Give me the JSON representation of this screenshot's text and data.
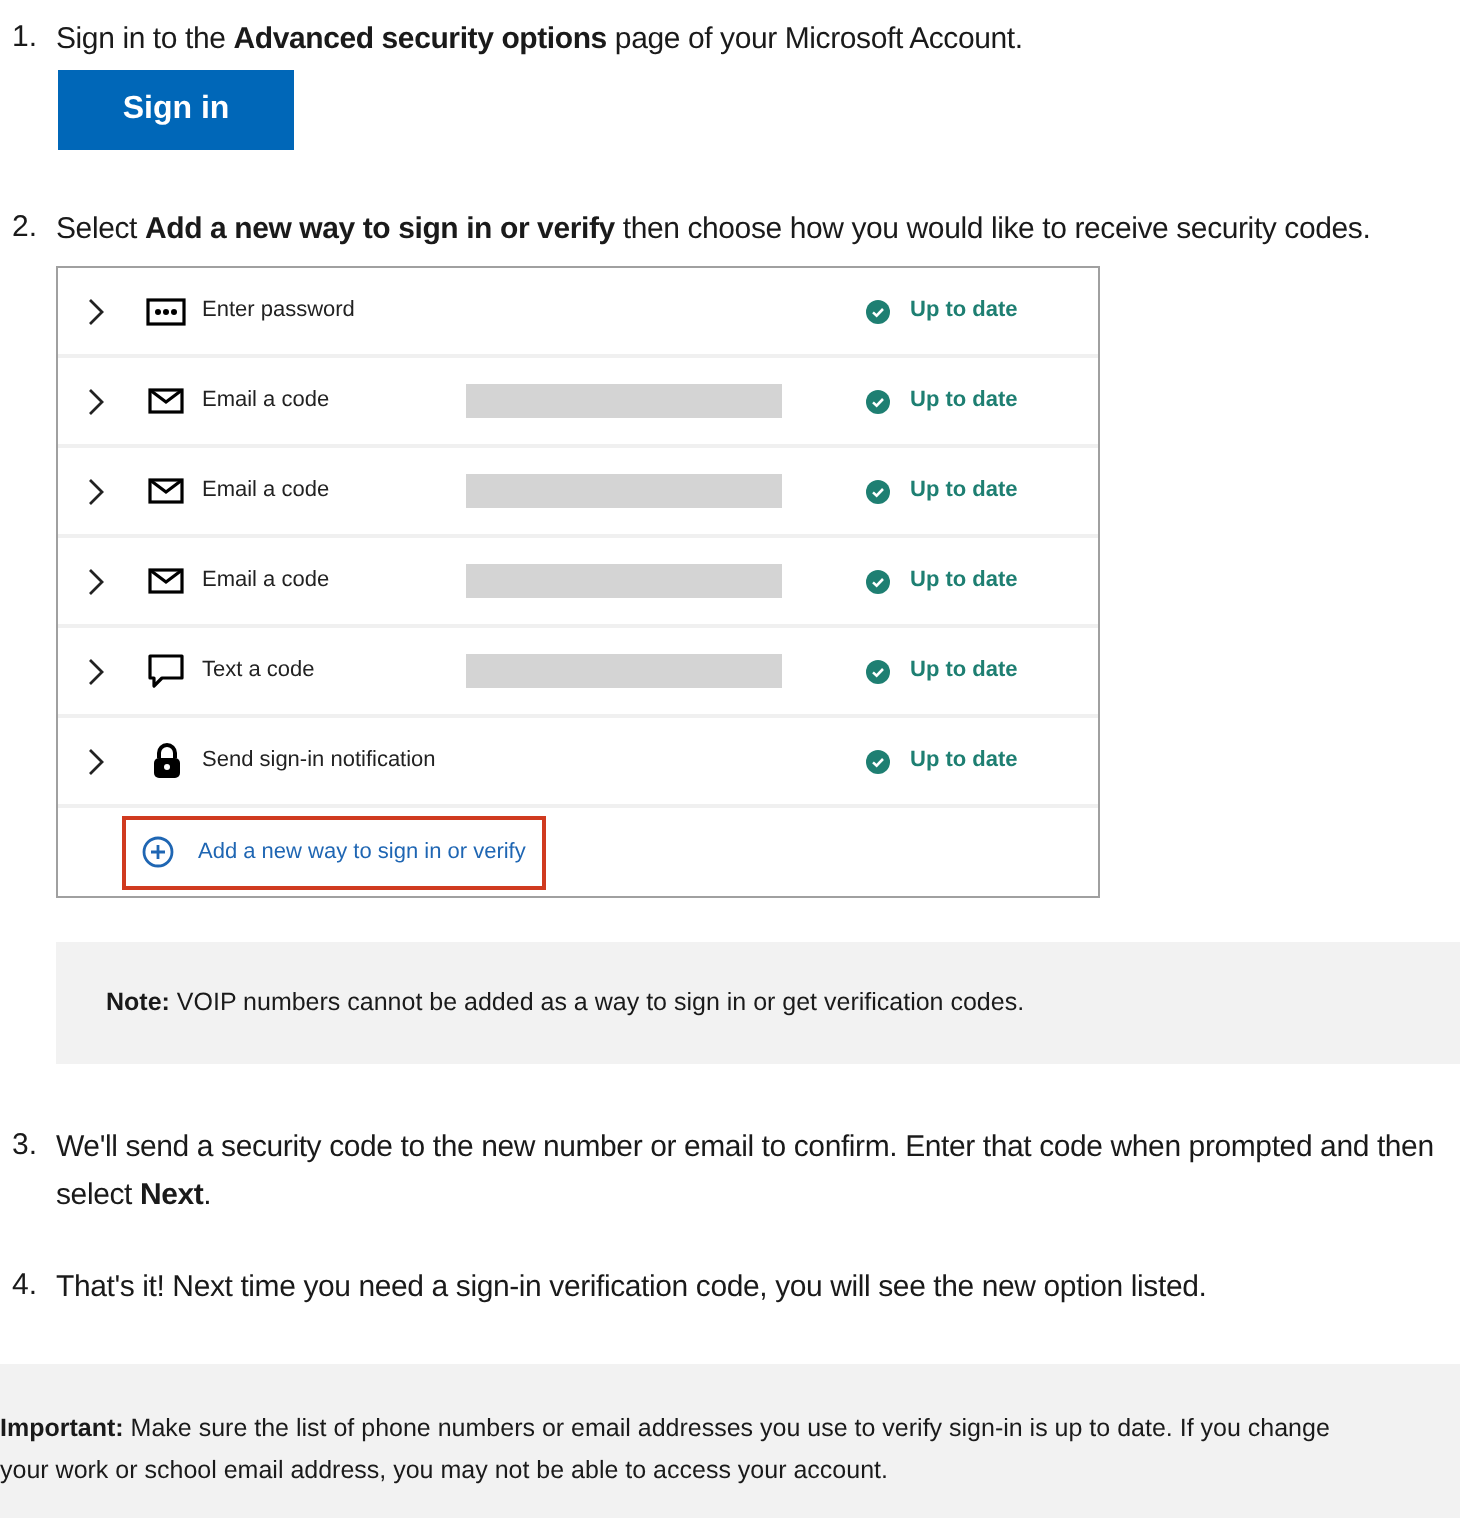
{
  "steps": [
    {
      "number": "1.",
      "text": "Sign in to the  **Advanced security options** page of your Microsoft Account.",
      "button": "Sign in"
    },
    {
      "number": "2.",
      "text": "Select **Add a new way to sign in or verify** then choose how you would like to receive security codes.",
      "methods": [
        {
          "kind": "password",
          "label": "Enter password",
          "masked": false,
          "status": "Up to date"
        },
        {
          "kind": "email",
          "label": "Email a code",
          "masked": true,
          "status": "Up to date"
        },
        {
          "kind": "email",
          "label": "Email a code",
          "masked": true,
          "status": "Up to date"
        },
        {
          "kind": "email",
          "label": "Email a code",
          "masked": true,
          "status": "Up to date"
        },
        {
          "kind": "text",
          "label": "Text a code",
          "masked": true,
          "status": "Up to date"
        },
        {
          "kind": "notification",
          "label": "Send sign-in notification",
          "masked": false,
          "status": "Up to date"
        }
      ],
      "add_link": "Add a new way to sign in or verify",
      "note": "**Note:** VOIP numbers cannot be added as a way to sign in or get verification codes."
    },
    {
      "number": "3.",
      "text": "We'll send a security code to the new number or email to confirm. Enter that code when prompted and then select **Next**."
    },
    {
      "number": "4.",
      "text": "That's it! Next time you need a sign-in verification code, you will see the new option listed."
    }
  ],
  "important": "**Important:** Make sure the list of phone numbers or email addresses you use to verify sign-in is up to date. If you change your work or school email address, you may not be able to access your account."
}
